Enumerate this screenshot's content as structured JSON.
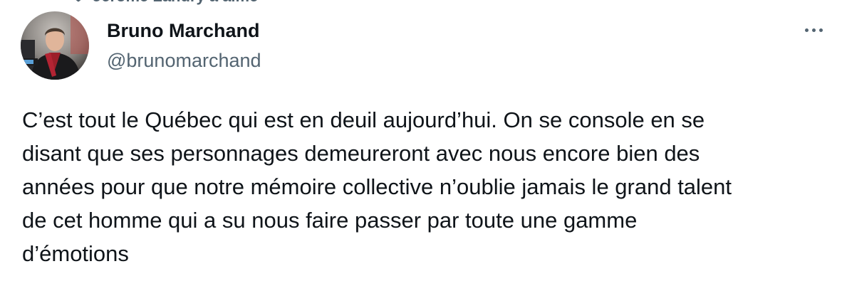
{
  "social_context": {
    "text": "Jérôme Landry a aimé"
  },
  "author": {
    "display_name": "Bruno Marchand",
    "handle": "@brunomarchand"
  },
  "tweet": {
    "text": "C’est tout le Québec qui est en deuil aujourd’hui. On se console en se\ndisant que ses personnages demeureront avec nous encore bien des\nannées pour que notre mémoire collective n’oublie jamais le grand talent\nde cet homme qui a su nous faire passer par toute une gamme\nd’émotions"
  },
  "icons": {
    "more": "more-horizontal-icon",
    "liked": "heart-icon"
  },
  "colors": {
    "primary_text": "#0f1419",
    "secondary_text": "#536471",
    "background": "#ffffff"
  }
}
